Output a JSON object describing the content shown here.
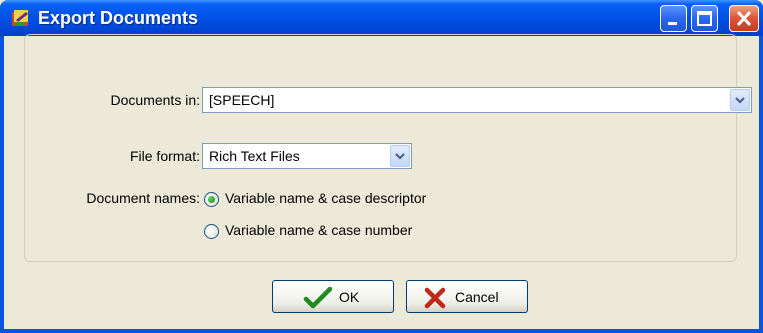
{
  "window": {
    "title": "Export Documents"
  },
  "form": {
    "documents_in_label": "Documents in:",
    "documents_in_value": "[SPEECH]",
    "file_format_label": "File format:",
    "file_format_value": "Rich Text Files",
    "document_names_label": "Document names:",
    "document_names_options": [
      {
        "label": "Variable name & case descriptor",
        "selected": true
      },
      {
        "label": "Variable name & case number",
        "selected": false
      }
    ]
  },
  "buttons": {
    "ok": "OK",
    "cancel": "Cancel"
  },
  "icons": {
    "title": "app-icon",
    "ok": "checkmark-icon",
    "cancel": "x-icon",
    "dropdown": "chevron-down-icon"
  }
}
